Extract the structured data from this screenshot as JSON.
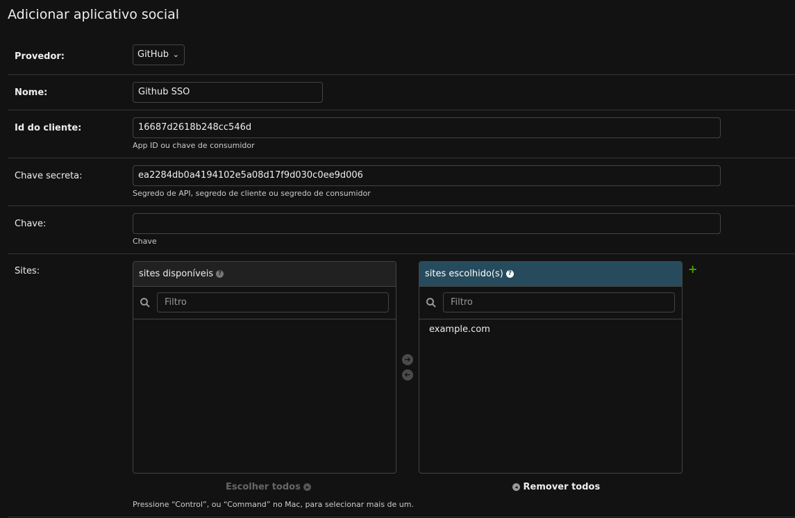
{
  "page": {
    "title": "Adicionar aplicativo social"
  },
  "form": {
    "provider": {
      "label": "Provedor:",
      "value": "GitHub"
    },
    "name": {
      "label": "Nome:",
      "value": "Github SSO"
    },
    "client_id": {
      "label": "Id do cliente:",
      "value": "16687d2618b248cc546d",
      "help": "App ID ou chave de consumidor"
    },
    "secret": {
      "label": "Chave secreta:",
      "value": "ea2284db0a4194102e5a08d17f9d030c0ee9d006",
      "help": "Segredo de API, segredo de cliente ou segredo de consumidor"
    },
    "key": {
      "label": "Chave:",
      "value": "",
      "help": "Chave"
    },
    "sites": {
      "label": "Sites:",
      "available_title": "sites disponíveis",
      "chosen_title": "sites escolhido(s)",
      "filter_placeholder": "Filtro",
      "available": [],
      "chosen": [
        "example.com"
      ],
      "choose_all": "Escolher todos",
      "remove_all": "Remover todos",
      "help": "Pressione “Control”, ou “Command” no Mac, para selecionar mais de um."
    }
  },
  "colors": {
    "accent": "#264b5d",
    "add": "#44aa00"
  }
}
